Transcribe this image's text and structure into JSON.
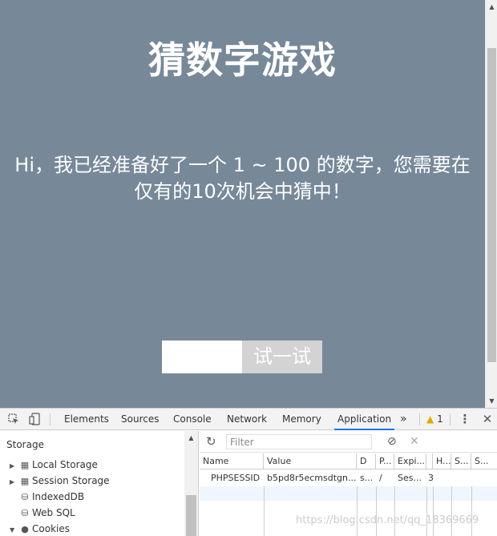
{
  "page": {
    "title": "猜数字游戏",
    "intro": "Hi，我已经准备好了一个 1 ~ 100 的数字，您需要在仅有的10次机会中猜中！",
    "guess_input_value": "",
    "guess_button_label": "试一试",
    "background_color": "#778899",
    "button_color": "#d3d3d3"
  },
  "scrollbar": {
    "up_icon": "scroll-up-arrow",
    "down_icon": "scroll-down-arrow"
  },
  "devtools": {
    "tabs": [
      {
        "label": "Elements"
      },
      {
        "label": "Sources"
      },
      {
        "label": "Console"
      },
      {
        "label": "Network"
      },
      {
        "label": "Memory"
      },
      {
        "label": "Application",
        "active": true
      }
    ],
    "more_tabs": "»",
    "warning_count": "1",
    "accent_color": "#1a73e8",
    "sidebar": {
      "heading": "Storage",
      "items": [
        {
          "label": "Local Storage",
          "expandable": true,
          "icon": "grid-icon"
        },
        {
          "label": "Session Storage",
          "expandable": true,
          "icon": "grid-icon"
        },
        {
          "label": "IndexedDB",
          "expandable": false,
          "icon": "database-icon"
        },
        {
          "label": "Web SQL",
          "expandable": false,
          "icon": "database-icon"
        },
        {
          "label": "Cookies",
          "expandable": true,
          "expanded": true,
          "icon": "cookie-icon"
        }
      ]
    },
    "filter": {
      "placeholder": "Filter",
      "value": ""
    },
    "table": {
      "columns": [
        "Name",
        "Value",
        "D",
        "P...",
        "Expi...",
        "H...",
        "S...",
        "S..."
      ],
      "rows": [
        {
          "name": "PHPSESSID",
          "value": "b5pd8r5ecmsdtgn...",
          "domain": "s...",
          "path": "/",
          "expires": "Ses...",
          "size": "3"
        }
      ]
    }
  },
  "watermark": "https://blog.csdn.net/qq_18369669"
}
